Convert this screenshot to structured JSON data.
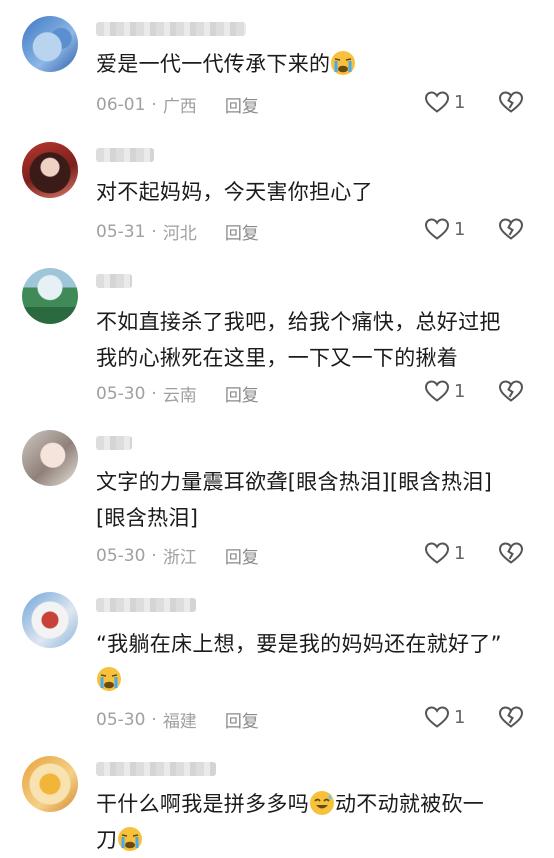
{
  "comments": [
    {
      "text": "爱是一代一代传承下来的",
      "emoji_after": "crying-emoji",
      "date": "06-01",
      "region": "广西",
      "reply": "回复",
      "likes": "1"
    },
    {
      "text": "对不起妈妈，今天害你担心了",
      "date": "05-31",
      "region": "河北",
      "reply": "回复",
      "likes": "1"
    },
    {
      "text": "不如直接杀了我吧，给我个痛快，总好过把\n我的心揪死在这里，一下又一下的揪着",
      "date": "05-30",
      "region": "云南",
      "reply": "回复",
      "likes": "1"
    },
    {
      "text": "文字的力量震耳欲聋[眼含热泪][眼含热泪]\n[眼含热泪]",
      "date": "05-30",
      "region": "浙江",
      "reply": "回复",
      "likes": "1"
    },
    {
      "text": "“我躺在床上想，要是我的妈妈还在就好了”",
      "emoji_line2": "crying-emoji",
      "date": "05-30",
      "region": "福建",
      "reply": "回复",
      "likes": "1"
    },
    {
      "text_a": "干什么啊我是拼多多吗",
      "text_b": "动不动就被砍一",
      "text_c": "刀",
      "emoji_mid": "sweat-smile-emoji",
      "emoji_end": "crying-emoji"
    }
  ]
}
